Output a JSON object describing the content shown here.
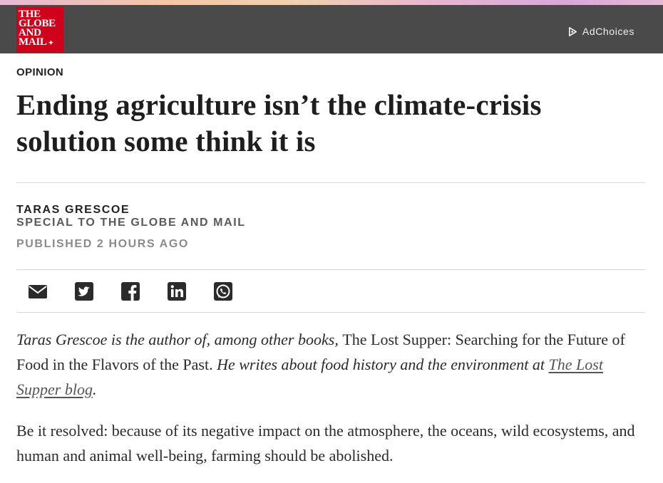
{
  "header": {
    "logo_lines": [
      "THE",
      "GLOBE",
      "AND",
      "MAIL"
    ],
    "logo_leaf": "✦",
    "adchoices_label": "AdChoices"
  },
  "article": {
    "section": "OPINION",
    "headline": "Ending agriculture isn’t the climate-crisis solution some think it is",
    "author": "TARAS GRESCOE",
    "affiliation": "SPECIAL TO THE GLOBE AND MAIL",
    "published": "PUBLISHED 2 HOURS AGO",
    "share_icons": [
      "email-icon",
      "twitter-icon",
      "facebook-icon",
      "linkedin-icon",
      "whatsapp-icon"
    ],
    "bio": {
      "part1": "Taras Grescoe is the author of, among other books, ",
      "book_title": "The Lost Supper: Searching for the Future of Food in the Flavors of the Past.",
      "part2": " He writes about food history and the environment at ",
      "link_text": "The Lost Supper blog",
      "part3": "."
    },
    "first_paragraph": "Be it resolved: because of its negative impact on the atmosphere, the oceans, wild ecosystems, and human and animal well-being, farming should be abolished."
  },
  "colors": {
    "header_bg": "#4a4a4a",
    "logo_red": "#d0021b"
  }
}
